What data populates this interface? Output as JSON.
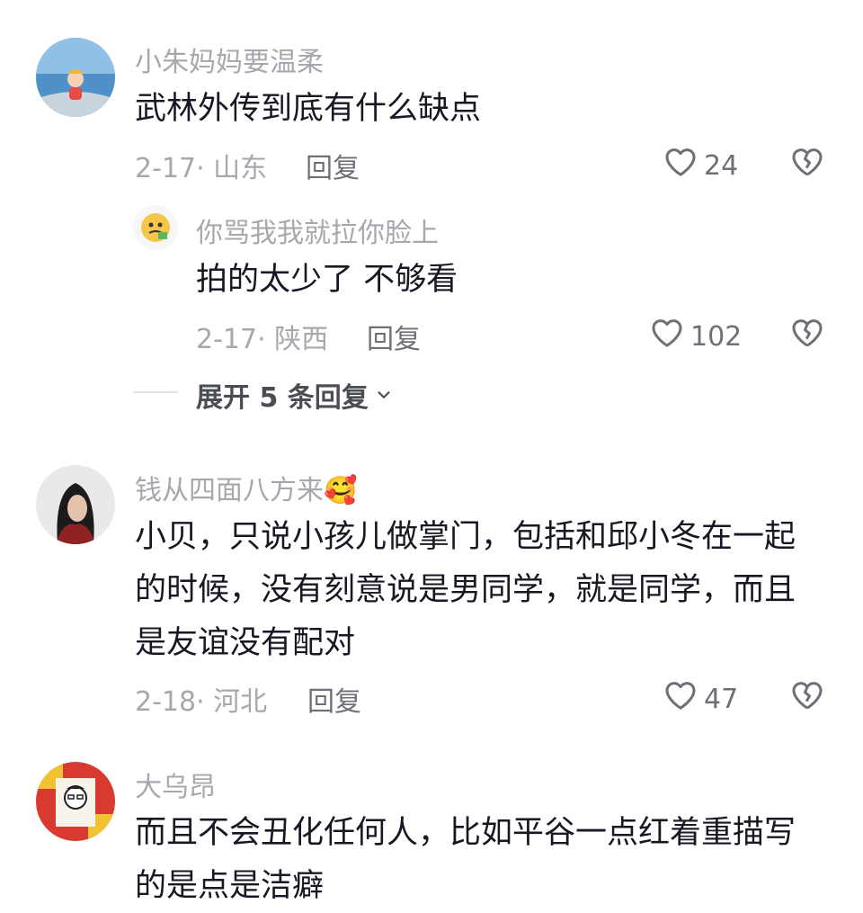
{
  "comments": [
    {
      "username": "小朱妈妈要温柔",
      "lines": [
        "武林外传到底有什么缺点"
      ],
      "date": "2-17",
      "location": "山东",
      "reply_label": "回复",
      "likes": "24"
    },
    {
      "username": "钱从四面八方来",
      "username_emoji": "🥰",
      "lines": [
        "小贝，只说小孩儿做掌门，包括和邱小冬在一起",
        "的时候，没有刻意说是男同学，就是同学，而且",
        "是友谊没有配对"
      ],
      "date": "2-18",
      "location": "河北",
      "reply_label": "回复",
      "likes": "47"
    },
    {
      "username": "大乌昂",
      "lines": [
        "而且不会丑化任何人，比如平谷一点红着重描写",
        "的是点是洁癖"
      ]
    }
  ],
  "reply": {
    "username": "你骂我我就拉你脸上",
    "lines": [
      "拍的太少了 不够看"
    ],
    "date": "2-17",
    "location": "陕西",
    "reply_label": "回复",
    "likes": "102"
  },
  "expand_replies": {
    "label": "展开 5 条回复"
  },
  "icons": {
    "like": "heart-outline-icon",
    "dislike": "broken-heart-icon",
    "expand": "chevron-down-icon"
  },
  "colors": {
    "text": "#161823",
    "secondary": "#a6a8ad",
    "action": "#6e7077"
  }
}
